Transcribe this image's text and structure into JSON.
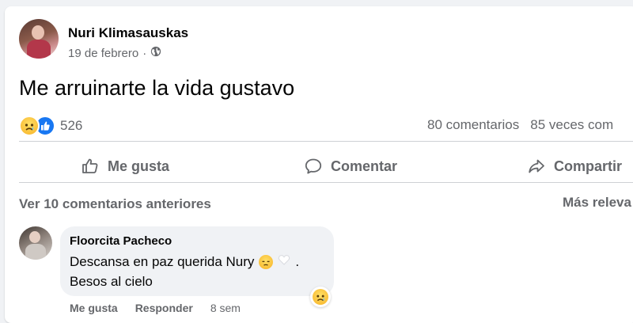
{
  "post": {
    "author": "Nuri Klimasauskas",
    "date": "19 de febrero",
    "date_separator": "·",
    "text": "Me arruinarte la vida gustavo",
    "reaction_count": "526",
    "comments_count": "80 comentarios",
    "shares_count": "85 veces com",
    "reaction_icons": [
      "sad-icon",
      "like-icon"
    ],
    "privacy_icon": "globe-icon"
  },
  "actions": {
    "like": "Me gusta",
    "comment": "Comentar",
    "share": "Compartir"
  },
  "comments_section": {
    "view_previous": "Ver 10 comentarios anteriores",
    "sort_label": "Más releva"
  },
  "comment": {
    "author": "Floorcita Pacheco",
    "line1": "Descansa en paz querida Nury",
    "line2": "Besos al cielo",
    "like_label": "Me gusta",
    "reply_label": "Responder",
    "time": "8 sem",
    "emojis": [
      "pensive-face-icon",
      "white-heart-icon"
    ],
    "reaction_icon": "sad-icon"
  },
  "colors": {
    "link_gray": "#65676b",
    "text": "#050505",
    "like_blue": "#1877f2",
    "emoji_yellow": "#f7b125",
    "bubble_bg": "#f0f2f5"
  }
}
